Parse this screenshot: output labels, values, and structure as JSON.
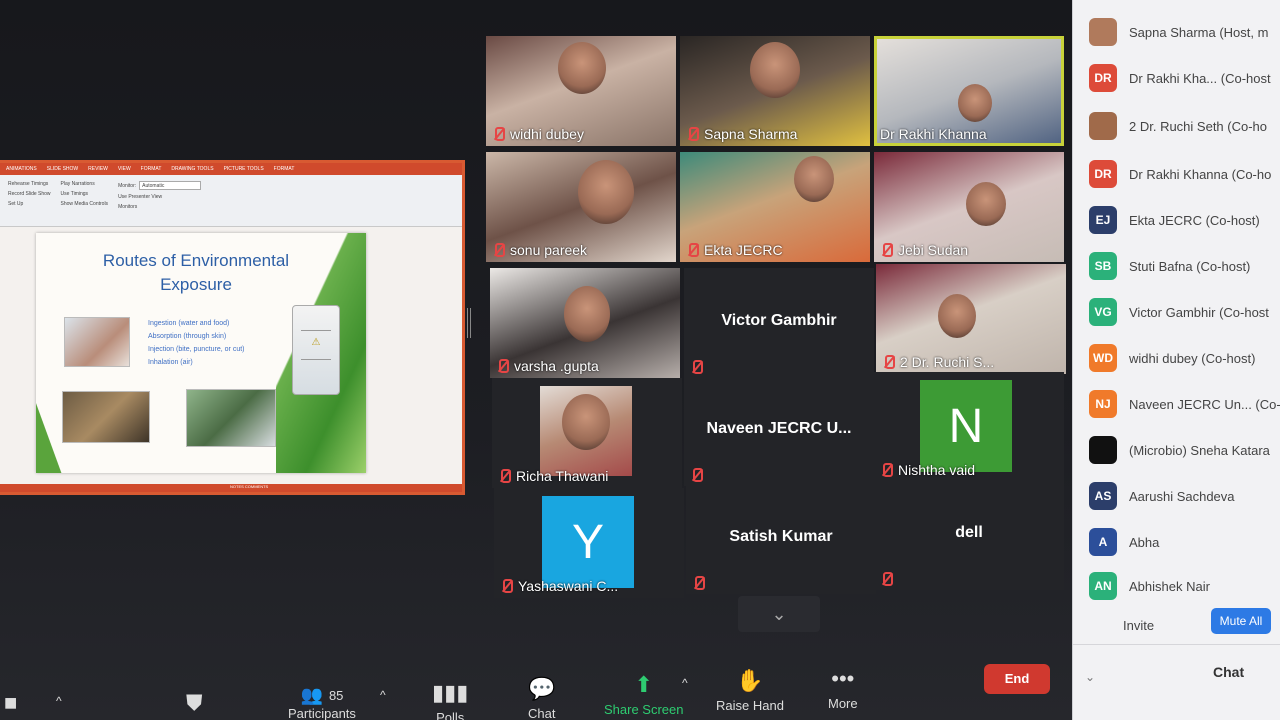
{
  "slide": {
    "tabs": [
      "ANIMATIONS",
      "SLIDE SHOW",
      "REVIEW",
      "VIEW",
      "FORMAT",
      "DRAWING TOOLS",
      "PICTURE TOOLS",
      "FORMAT"
    ],
    "ribbon": {
      "rehearse": "Rehearse Timings",
      "record": "Record Slide Show",
      "play_narrations": "Play Narrations",
      "use_timings": "Use Timings",
      "show_media": "Show Media Controls",
      "monitor_label": "Monitor:",
      "monitor_value": "Automatic",
      "presenter_view": "Use Presenter View",
      "group_setup": "Set Up",
      "group_monitors": "Monitors"
    },
    "title_line1": "Routes of Environmental",
    "title_line2": "Exposure",
    "bullets": [
      "Ingestion (water and food)",
      "Absorption (through skin)",
      "Injection (bite, puncture, or cut)",
      "Inhalation (air)"
    ],
    "bottle_label": "⚠",
    "status": "NOTES   COMMENTS"
  },
  "tiles": [
    {
      "name": "widhi dubey"
    },
    {
      "name": "Sapna Sharma"
    },
    {
      "name": "Dr Rakhi Khanna"
    },
    {
      "name": "sonu pareek"
    },
    {
      "name": "Ekta JECRC"
    },
    {
      "name": "Jebi Sudan"
    },
    {
      "name": "varsha .gupta"
    },
    {
      "name": "Victor Gambhir"
    },
    {
      "name": "2 Dr. Ruchi S..."
    },
    {
      "name": "Richa Thawani"
    },
    {
      "name": "Naveen JECRC U..."
    },
    {
      "name": "Nishtha vaid",
      "initial": "N"
    },
    {
      "name": "Yashaswani C...",
      "initial": "Y"
    },
    {
      "name": "Satish Kumar"
    },
    {
      "name": "dell"
    }
  ],
  "more_pages_icon": "⌄",
  "toolbar": {
    "participants_count": "85",
    "participants_label": "Participants",
    "polls": "Polls",
    "chat": "Chat",
    "share_screen": "Share Screen",
    "raise_hand": "Raise Hand",
    "more": "More",
    "end": "End"
  },
  "participants": [
    {
      "initials": "",
      "name": "Sapna Sharma (Host, m",
      "color": "#b07a5c"
    },
    {
      "initials": "DR",
      "name": "Dr Rakhi Kha...  (Co-host",
      "color": "#dd4b39"
    },
    {
      "initials": "",
      "name": "2 Dr. Ruchi Seth (Co-ho",
      "color": "#a06a4a"
    },
    {
      "initials": "DR",
      "name": "Dr Rakhi Khanna (Co-ho",
      "color": "#dd4b39"
    },
    {
      "initials": "EJ",
      "name": "Ekta JECRC (Co-host)",
      "color": "#2c3e6a"
    },
    {
      "initials": "SB",
      "name": "Stuti Bafna (Co-host)",
      "color": "#2bb17a"
    },
    {
      "initials": "VG",
      "name": "Victor Gambhir (Co-host",
      "color": "#2bb17a"
    },
    {
      "initials": "WD",
      "name": "widhi dubey (Co-host)",
      "color": "#f07a2a"
    },
    {
      "initials": "NJ",
      "name": "Naveen JECRC Un... (Co-h",
      "color": "#f07a2a"
    },
    {
      "initials": "",
      "name": "(Microbio) Sneha Katara",
      "color": "#111111"
    },
    {
      "initials": "AS",
      "name": "Aarushi Sachdeva",
      "color": "#2c3e6a"
    },
    {
      "initials": "A",
      "name": "Abha",
      "color": "#2c4f9a"
    },
    {
      "initials": "AN",
      "name": "Abhishek Nair",
      "color": "#2bb17a"
    }
  ],
  "panel": {
    "invite": "Invite",
    "mute_all": "Mute All",
    "chat": "Chat"
  },
  "colors": {
    "end_button": "#d0392f",
    "speaker_outline": "#c8d23a",
    "mute_all": "#2d7ae5",
    "ppt_accent": "#d04a2c"
  }
}
